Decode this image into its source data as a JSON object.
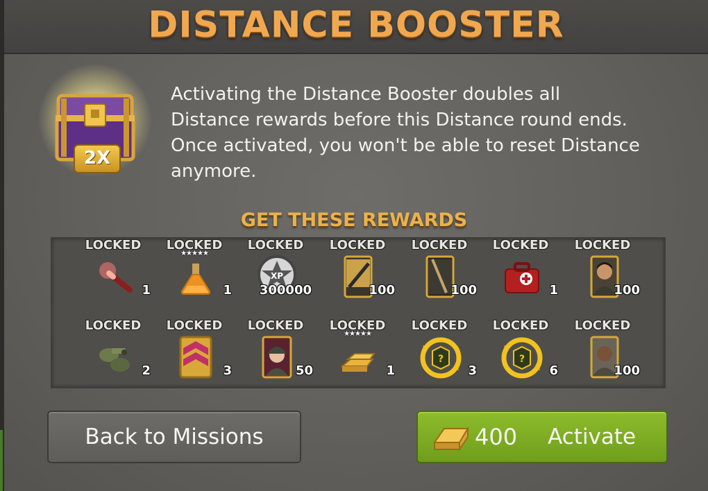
{
  "title": "DISTANCE BOOSTER",
  "chest_badge": "2X",
  "description": "Activating the Distance Booster doubles all\nDistance rewards before this Distance round ends.\n Once activated, you won't be able to reset Distance\nanymore.",
  "rewards_title": "GET THESE REWARDS",
  "rewards_row1": [
    {
      "status": "LOCKED",
      "icon": "flare-icon",
      "count": "1",
      "stars": ""
    },
    {
      "status": "LOCKED",
      "icon": "potion-flask-icon",
      "count": "1",
      "stars": "★★★★★"
    },
    {
      "status": "LOCKED",
      "icon": "xp-badge-icon",
      "count": "300000",
      "stars": ""
    },
    {
      "status": "LOCKED",
      "icon": "weapon-card-icon",
      "count": "100",
      "stars": ""
    },
    {
      "status": "LOCKED",
      "icon": "weapon-card-icon",
      "count": "100",
      "stars": ""
    },
    {
      "status": "LOCKED",
      "icon": "medkit-icon",
      "count": "1",
      "stars": ""
    },
    {
      "status": "LOCKED",
      "icon": "survivor-portrait-icon",
      "count": "100",
      "stars": ""
    }
  ],
  "rewards_row2": [
    {
      "status": "LOCKED",
      "icon": "scrap-parts-icon",
      "count": "2",
      "stars": ""
    },
    {
      "status": "LOCKED",
      "icon": "rank-chevron-icon",
      "count": "3",
      "stars": ""
    },
    {
      "status": "LOCKED",
      "icon": "soldier-portrait-icon",
      "count": "50",
      "stars": ""
    },
    {
      "status": "LOCKED",
      "icon": "gold-bars-icon",
      "count": "1",
      "stars": "★★★★★"
    },
    {
      "status": "LOCKED",
      "icon": "mystery-box-icon",
      "count": "3",
      "stars": ""
    },
    {
      "status": "LOCKED",
      "icon": "mystery-box-icon",
      "count": "6",
      "stars": ""
    },
    {
      "status": "LOCKED",
      "icon": "survivor-portrait-icon",
      "count": "100",
      "stars": ""
    }
  ],
  "buttons": {
    "back": "Back to Missions",
    "activate_cost": "400",
    "activate": "Activate"
  },
  "colors": {
    "title": "#f0a850",
    "rewards_title": "#e8b24e",
    "activate_green": "#7fae24",
    "chest_purple": "#6a3a8c"
  }
}
